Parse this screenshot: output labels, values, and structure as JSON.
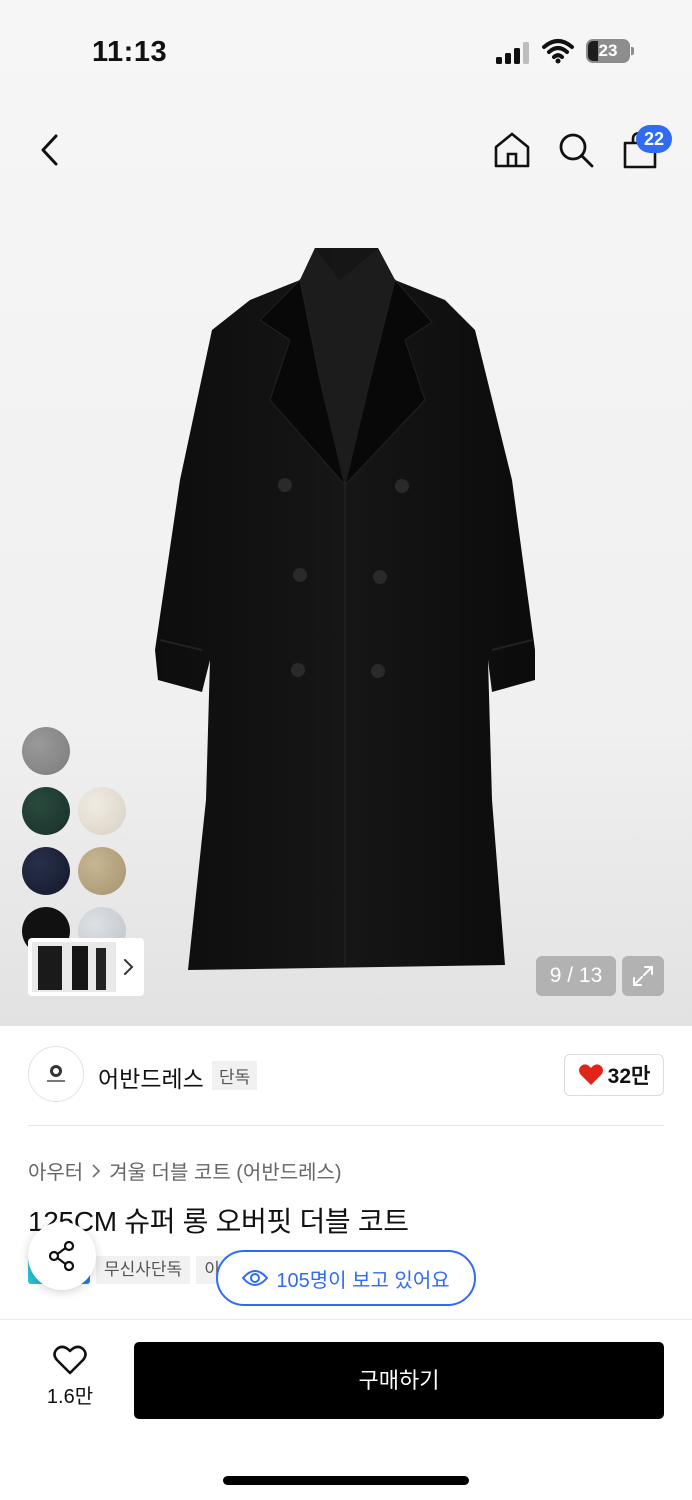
{
  "status_bar": {
    "time": "11:13",
    "battery": "23"
  },
  "nav": {
    "cart_count": "22"
  },
  "gallery": {
    "counter": "9 / 13"
  },
  "swatches": [
    {
      "name": "gray",
      "color": "#8b8b8b"
    },
    {
      "name": "green",
      "color": "#1f3a30"
    },
    {
      "name": "oatmeal",
      "color": "#e6e0d6"
    },
    {
      "name": "navy",
      "color": "#1b2236"
    },
    {
      "name": "beige",
      "color": "#b8a683"
    },
    {
      "name": "black",
      "color": "#111111"
    },
    {
      "name": "light-gray",
      "color": "#cfd2d6"
    }
  ],
  "brand": {
    "name": "어반드레스",
    "tag": "단독",
    "likes": "32만"
  },
  "breadcrumb": {
    "level1": "아우터",
    "level2": "겨울 더블 코트 (어반드레스)"
  },
  "product": {
    "title": "125CM 슈퍼 롱 오버핏 더블 코트"
  },
  "tags": {
    "exclusive": "무신사단독",
    "partial": "이"
  },
  "viewers": {
    "text": "105명이 보고 있어요"
  },
  "bottom": {
    "wish_count": "1.6만",
    "buy_label": "구매하기"
  },
  "colors": {
    "accent": "#2f6bf5",
    "heart": "#e1251b"
  }
}
